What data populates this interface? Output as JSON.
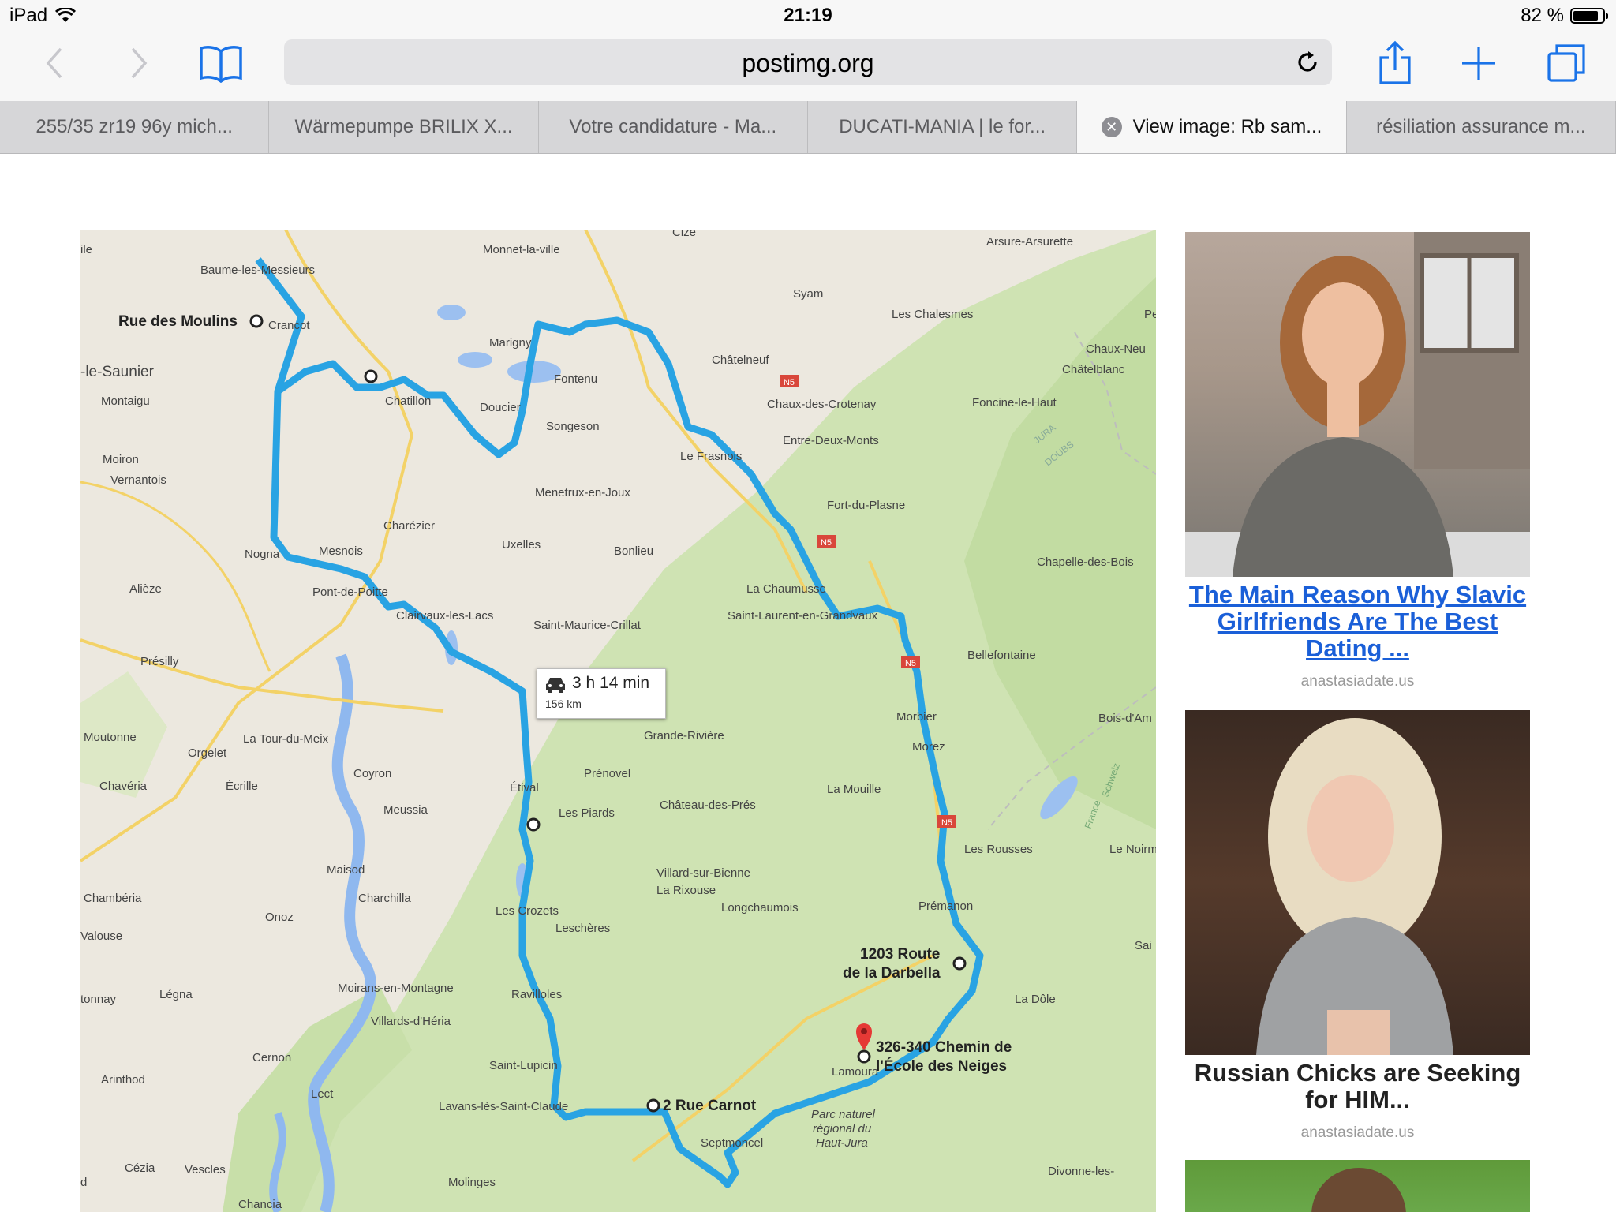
{
  "status_bar": {
    "device": "iPad",
    "time": "21:19",
    "battery": "82 %"
  },
  "toolbar": {
    "back_icon": "chevron-left-icon",
    "forward_icon": "chevron-right-icon",
    "bookmarks_icon": "open-book-icon",
    "url": "postimg.org",
    "reload_icon": "reload-icon",
    "share_icon": "share-icon",
    "new_tab_icon": "plus-icon",
    "tabs_icon": "tabs-icon"
  },
  "tabs": [
    {
      "label": "255/35 zr19 96y mich...",
      "active": false
    },
    {
      "label": "Wärmepumpe BRILIX X...",
      "active": false
    },
    {
      "label": "Votre candidature - Ma...",
      "active": false
    },
    {
      "label": "DUCATI-MANIA | le for...",
      "active": false
    },
    {
      "label": "View image: Rb sam...",
      "active": true
    },
    {
      "label": "résiliation assurance m...",
      "active": false
    }
  ],
  "map": {
    "route_time": "3 h 14 min",
    "route_distance": "156 km",
    "waypoints": {
      "start": "Rue des Moulins",
      "darbella_line1": "1203 Route",
      "darbella_line2": "de la Darbella",
      "destination_line1": "326-340 Chemin de",
      "destination_line2": "l'École des Neiges",
      "carnot": "2 Rue Carnot"
    },
    "places": {
      "ile": "ile",
      "baume": "Baume-les-Messieurs",
      "monnet": "Monnet-la-ville",
      "cize": "Cize",
      "arsure": "Arsure-Arsurette",
      "syam": "Syam",
      "chalesmes": "Les Chalesmes",
      "pe": "Pe",
      "crancot": "Crancot",
      "marigny": "Marigny",
      "chateauneuf": "Châtelneuf",
      "chauxneu": "Chaux-Neu",
      "chatelblanc": "Châtelblanc",
      "saunier": "-le-Saunier",
      "fontenu": "Fontenu",
      "montaigu": "Montaigu",
      "chatillon": "Chatillon",
      "doucier": "Doucier",
      "chauxcrotenay": "Chaux-des-Crotenay",
      "foncine": "Foncine-le-Haut",
      "songeson": "Songeson",
      "jura": "JURA",
      "doubs": "DOUBS",
      "moiron": "Moiron",
      "frasnois": "Le Frasnois",
      "entredeux": "Entre-Deux-Monts",
      "vernantois": "Vernantois",
      "menetrux": "Menetrux-en-Joux",
      "fortduplasne": "Fort-du-Plasne",
      "charezier": "Charézier",
      "uxelles": "Uxelles",
      "bonlieu": "Bonlieu",
      "mesnois": "Mesnois",
      "nogna": "Nogna",
      "chapelle": "Chapelle-des-Bois",
      "alieze": "Alièze",
      "pontdepoitte": "Pont-de-Poitte",
      "chaumusse": "La Chaumusse",
      "clairvaux": "Clairvaux-les-Lacs",
      "stlaurent": "Saint-Laurent-en-Grandvaux",
      "stmaurice": "Saint-Maurice-Crillat",
      "presilly": "Présilly",
      "bellefontaine": "Bellefontaine",
      "morbier": "Morbier",
      "boisda": "Bois-d'Am",
      "moutonne": "Moutonne",
      "latour": "La Tour-du-Meix",
      "granderiviere": "Grande-Rivière",
      "orgelet": "Orgelet",
      "morez": "Morez",
      "coyron": "Coyron",
      "prenovel": "Prénovel",
      "chaveria": "Chavéria",
      "ecrille": "Écrille",
      "etival": "Étival",
      "lamouille": "La Mouille",
      "chateaudespres": "Château-des-Prés",
      "meussia": "Meussia",
      "lespiards": "Les Piards",
      "france": "France",
      "schweiz": "Schweiz",
      "lesrousses": "Les Rousses",
      "lenoirmont": "Le Noirm",
      "maisod": "Maisod",
      "villard": "Villard-sur-Bienne",
      "larixouse": "La Rixouse",
      "chambria": "Chambéria",
      "charchilla": "Charchilla",
      "longchaumois": "Longchaumois",
      "premanon": "Prémanon",
      "lescrozets": "Les Crozets",
      "onoz": "Onoz",
      "valouse": "Valouse",
      "lescheres": "Leschères",
      "sai": "Sai",
      "tonnay": "tonnay",
      "legna": "Légna",
      "moirans": "Moirans-en-Montagne",
      "ravilloles": "Ravilloles",
      "ladole": "La Dôle",
      "villards": "Villards-d'Héria",
      "cernon": "Cernon",
      "stlupicin": "Saint-Lupicin",
      "arinthod": "Arinthod",
      "lect": "Lect",
      "lamoura": "Lamoura",
      "lavans": "Lavans-lès-Saint-Claude",
      "parc1": "Parc naturel",
      "parc2": "régional du",
      "parc3": "Haut-Jura",
      "septmoncel": "Septmoncel",
      "cezia": "Cézia",
      "vescles": "Vescles",
      "molinges": "Molinges",
      "divonne": "Divonne-les-",
      "d": "d",
      "chancia": "Chancia",
      "n5a": "N5",
      "n5b": "N5",
      "n5c": "N5",
      "n5d": "N5"
    }
  },
  "ads": [
    {
      "title": "The Main Reason Why Slavic Girlfriends Are The Best Dating ...",
      "source": "anastasiadate.us"
    },
    {
      "title": "Russian Chicks are Seeking for HIM...",
      "source": "anastasiadate.us"
    }
  ],
  "colors": {
    "route": "#29a3e3",
    "link": "#1a5fd8",
    "ios_blue": "#1a73e8"
  }
}
